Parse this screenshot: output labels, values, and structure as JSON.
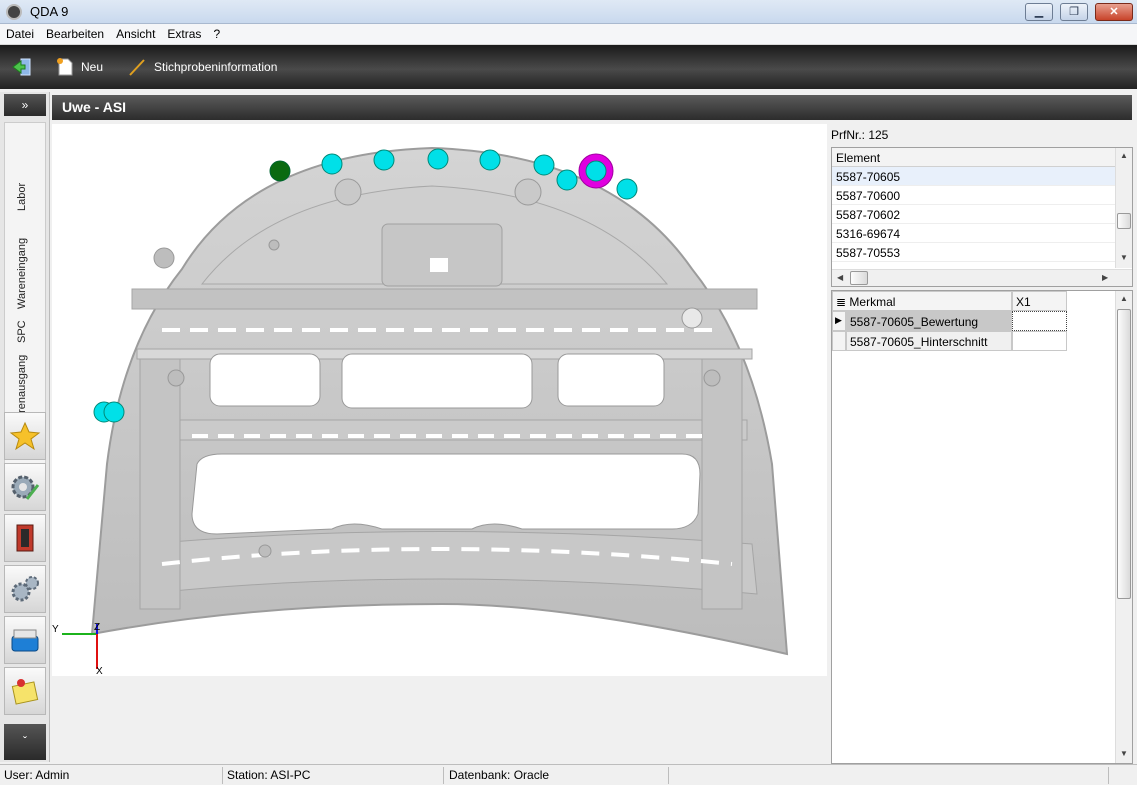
{
  "window": {
    "title": "QDA 9"
  },
  "menu": {
    "items": [
      "Datei",
      "Bearbeiten",
      "Ansicht",
      "Extras",
      "?"
    ]
  },
  "toolbar": {
    "new_label": "Neu",
    "sample_info_label": "Stichprobeninformation"
  },
  "sidebar": {
    "expand_label": "»",
    "collapse_label": "ˇ",
    "tabs": [
      "Labor",
      "Wareneingang",
      "SPC",
      "Warenausgang"
    ],
    "buttons": [
      "star-icon",
      "settings-edit-icon",
      "exit-door-icon",
      "gears-icon",
      "database-icon",
      "notepad-icon"
    ]
  },
  "main": {
    "header": "Uwe - ASI"
  },
  "viewport": {
    "axis_labels": {
      "y": "Y",
      "z": "Z",
      "x": "X"
    },
    "accent_color": "#00e0e8",
    "highlight_color": "#e000e0",
    "ok_color": "#0a6a10"
  },
  "panel": {
    "prfnr": "PrfNr.: 125",
    "element_header": "Element",
    "elements": [
      "5587-70605",
      "5587-70600",
      "5587-70602",
      "5316-69674",
      "5587-70553"
    ],
    "merkmal_header": "Merkmal",
    "x1_header": "X1",
    "merkmale": [
      "5587-70605_Bewertung",
      "5587-70605_Hinterschnitt"
    ]
  },
  "status": {
    "user": "User: Admin",
    "station": "Station: ASI-PC",
    "database": "Datenbank: Oracle"
  }
}
